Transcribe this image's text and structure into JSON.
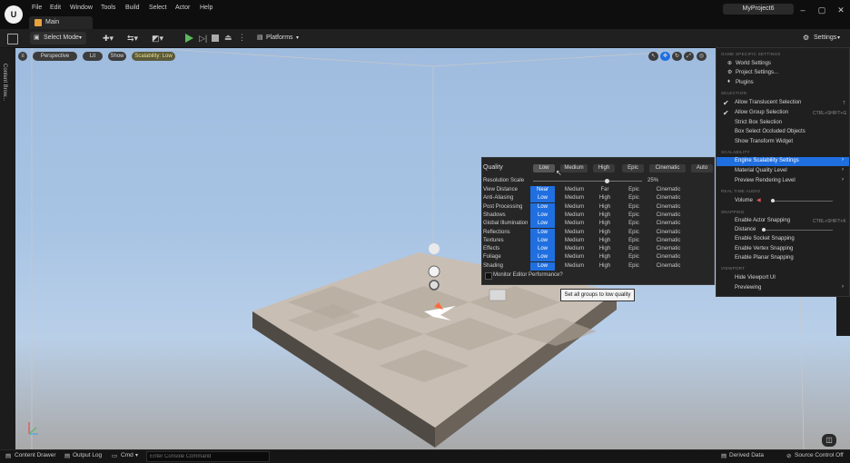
{
  "app": {
    "project_name": "MyProject6",
    "tab_label": "Main"
  },
  "menu": [
    "File",
    "Edit",
    "Window",
    "Tools",
    "Build",
    "Select",
    "Actor",
    "Help"
  ],
  "toolbar": {
    "select_mode": "Select Mode",
    "platforms": "Platforms",
    "settings": "Settings"
  },
  "viewport": {
    "perspective": "Perspective",
    "lit": "Lit",
    "show": "Show",
    "scalability": "Scalability: Low"
  },
  "side": {
    "content_browser": "Content Brow..."
  },
  "quality": {
    "title": "Quality",
    "levels": [
      "Low",
      "Medium",
      "High",
      "Epic",
      "Cinematic",
      "Auto"
    ],
    "resolution_scale_label": "Resolution Scale",
    "resolution_scale_value": "25%",
    "resolution_scale_fraction": 0.25,
    "rows": [
      {
        "label": "View Distance",
        "values": [
          "Near",
          "Medium",
          "Far",
          "Epic",
          "Cinematic"
        ]
      },
      {
        "label": "Anti-Aliasing",
        "values": [
          "Low",
          "Medium",
          "High",
          "Epic",
          "Cinematic"
        ]
      },
      {
        "label": "Post Processing",
        "values": [
          "Low",
          "Medium",
          "High",
          "Epic",
          "Cinematic"
        ]
      },
      {
        "label": "Shadows",
        "values": [
          "Low",
          "Medium",
          "High",
          "Epic",
          "Cinematic"
        ]
      },
      {
        "label": "Global Illumination",
        "values": [
          "Low",
          "Medium",
          "High",
          "Epic",
          "Cinematic"
        ]
      },
      {
        "label": "Reflections",
        "values": [
          "Low",
          "Medium",
          "High",
          "Epic",
          "Cinematic"
        ]
      },
      {
        "label": "Textures",
        "values": [
          "Low",
          "Medium",
          "High",
          "Epic",
          "Cinematic"
        ]
      },
      {
        "label": "Effects",
        "values": [
          "Low",
          "Medium",
          "High",
          "Epic",
          "Cinematic"
        ]
      },
      {
        "label": "Foliage",
        "values": [
          "Low",
          "Medium",
          "High",
          "Epic",
          "Cinematic"
        ]
      },
      {
        "label": "Shading",
        "values": [
          "Low",
          "Medium",
          "High",
          "Epic",
          "Cinematic"
        ]
      }
    ],
    "monitor": "Monitor Editor Performance?",
    "tooltip": "Set all groups to low quality"
  },
  "settings_menu": {
    "section_game": "GAME SPECIFIC SETTINGS",
    "world_settings": "World Settings",
    "project_settings": "Project Settings...",
    "plugins": "Plugins",
    "section_selection": "SELECTION",
    "allow_translucent": "Allow Translucent Selection",
    "allow_translucent_shortcut": "T",
    "allow_group": "Allow Group Selection",
    "allow_group_shortcut": "CTRL+SHIFT+G",
    "strict_box": "Strict Box Selection",
    "box_occluded": "Box Select Occluded Objects",
    "show_transform": "Show Transform Widget",
    "section_scalability": "SCALABILITY",
    "engine_scalability": "Engine Scalability Settings",
    "material_quality": "Material Quality Level",
    "preview_rendering": "Preview Rendering Level",
    "section_realtime_audio": "REAL TIME AUDIO",
    "volume": "Volume",
    "section_snapping": "SNAPPING",
    "enable_actor_snapping": "Enable Actor Snapping",
    "enable_actor_snapping_shortcut": "CTRL+SHIFT+K",
    "distance": "Distance",
    "enable_socket": "Enable Socket Snapping",
    "enable_vertex": "Enable Vertex Snapping",
    "enable_planar": "Enable Planar Snapping",
    "section_viewport": "VIEWPORT",
    "hide_viewport_ui": "Hide Viewport UI",
    "previewing": "Previewing"
  },
  "status": {
    "content_drawer": "Content Drawer",
    "output_log": "Output Log",
    "cmd": "Cmd",
    "console_placeholder": "Enter Console Command",
    "derived_data": "Derived Data",
    "source_control": "Source Control Off"
  },
  "colors": {
    "accent": "#1f6fe0",
    "play": "#5cb85c"
  }
}
